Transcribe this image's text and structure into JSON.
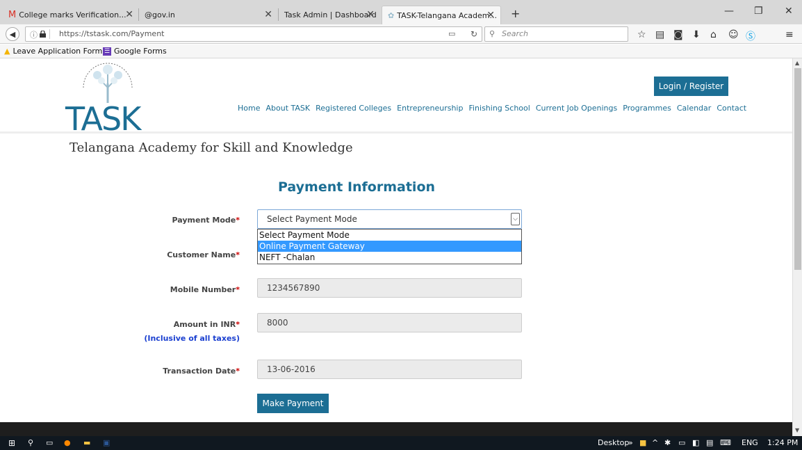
{
  "tabs": [
    {
      "label": "College marks Verification...",
      "close": "✕"
    },
    {
      "label": "@gov.in",
      "close": "✕"
    },
    {
      "label": "Task Admin | Dashboard",
      "close": "✕"
    },
    {
      "label": "TASK-Telangana Academ...",
      "close": "✕"
    }
  ],
  "new_tab": "+",
  "window_controls": {
    "minimize": "—",
    "restore": "❐",
    "close": "✕"
  },
  "url": "https://tstask.com/Payment",
  "search_placeholder": "Search",
  "bookmarks": [
    {
      "label": "Leave Application Form"
    },
    {
      "label": "Google Forms"
    }
  ],
  "site": {
    "logo": "TASK",
    "login_label": "Login / Register",
    "nav": [
      "Home",
      "About TASK",
      "Registered Colleges",
      "Entrepreneurship",
      "Finishing School",
      "Current Job Openings",
      "Programmes",
      "Calendar",
      "Contact"
    ],
    "academy_name": "Telangana Academy for Skill and Knowledge"
  },
  "form": {
    "title": "Payment Information",
    "payment_mode_label": "Payment Mode",
    "payment_mode_value": "Select Payment Mode",
    "payment_mode_options": [
      "Select Payment Mode",
      "Online Payment Gateway",
      "NEFT -Chalan"
    ],
    "payment_mode_highlighted": "Online Payment Gateway",
    "customer_name_label": "Customer Name",
    "mobile_label": "Mobile Number",
    "mobile_value": "1234567890",
    "amount_label": "Amount in INR",
    "amount_note": "(Inclusive of all taxes)",
    "amount_value": "8000",
    "date_label": "Transaction Date",
    "date_value": "13-06-2016",
    "required_mark": "*",
    "submit_label": "Make Payment"
  },
  "taskbar": {
    "desktop_label": "Desktop",
    "lang": "ENG",
    "time": "1:24 PM"
  },
  "colors": {
    "brand": "#1c6e94",
    "required": "#cc0000",
    "highlight": "#3399ff"
  }
}
